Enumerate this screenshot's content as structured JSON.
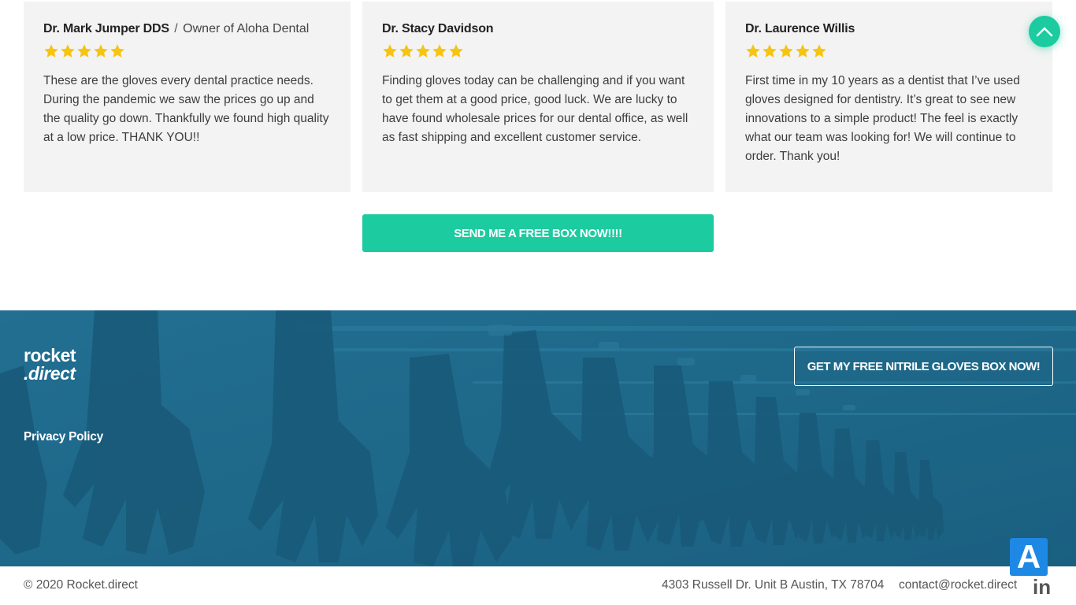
{
  "colors": {
    "accent": "#1ccb9f",
    "footer_bg": "#1f6a8c",
    "star": "#f6c413",
    "card_bg": "#f3f3f3",
    "a11y_bg": "#1e88e5"
  },
  "testimonials": [
    {
      "name": "Dr. Mark Jumper DDS",
      "separator": "/",
      "role": "Owner of Aloha Dental",
      "rating": 5,
      "quote": "These are the gloves every dental practice needs. During the pandemic we saw the prices go up and the quality go down. Thankfully we found high quality at a low price. THANK YOU!!"
    },
    {
      "name": "Dr. Stacy Davidson",
      "rating": 5,
      "quote": "Finding gloves today can be challenging and if you want to get them at a good price, good luck. We are lucky to have found wholesale prices for our dental office, as well as fast shipping and excellent customer service."
    },
    {
      "name": "Dr. Laurence Willis",
      "rating": 5,
      "quote": "First time in my 10 years as a dentist that I’ve used gloves designed for dentistry. It’s great to see new innovations to a simple product! The feel is exactly what our team was looking for! We will continue to order. Thank you!"
    }
  ],
  "cta_main": "SEND ME A FREE BOX NOW!!!!",
  "scroll_top_icon": "chevron-up-icon",
  "footer": {
    "logo_line1": "rocket",
    "logo_line2": ".direct",
    "privacy_link": "Privacy Policy",
    "cta": "GET MY FREE NITRILE GLOVES BOX NOW!"
  },
  "bottom": {
    "copyright": "© 2020 Rocket.direct",
    "address": "4303 Russell Dr. Unit B Austin, TX 78704",
    "email": "contact@rocket.direct",
    "linkedin": "in"
  },
  "accessibility_button": "A"
}
